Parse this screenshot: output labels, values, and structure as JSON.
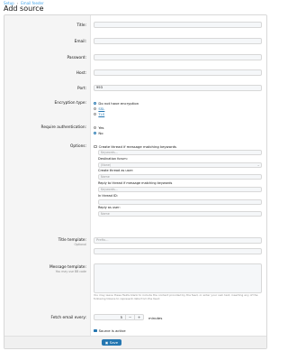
{
  "breadcrumb": {
    "item1": "Setup",
    "item2": "Email feeder"
  },
  "page_title": "Add source",
  "fields": {
    "title": {
      "label": "Title:",
      "value": ""
    },
    "email": {
      "label": "Email:",
      "value": ""
    },
    "password": {
      "label": "Password:",
      "value": ""
    },
    "host": {
      "label": "Host:",
      "value": ""
    },
    "port": {
      "label": "Port:",
      "value": "993"
    }
  },
  "encryption": {
    "label": "Encryption type:",
    "options": [
      "Do not have encryption",
      "SSL",
      "TLS"
    ],
    "selected": "Do not have encryption"
  },
  "auth": {
    "label": "Require authentication:",
    "options": [
      "Yes",
      "No"
    ],
    "selected": "No"
  },
  "options": {
    "label": "Options:",
    "checkbox_label": "Create thread if message matching keywords",
    "keywords_placeholder": "Keywords...",
    "destination_label": "Destination forum:",
    "destination_value": "(None)",
    "create_as_label": "Create thread as user:",
    "create_as_placeholder": "Name",
    "reply_label": "Reply to thread if message matching keywords",
    "reply_keywords_placeholder": "Keywords...",
    "thread_id_label": "In thread ID:",
    "reply_as_label": "Reply as user:",
    "reply_as_placeholder": "Name"
  },
  "title_template": {
    "label": "Title template:",
    "sublabel": "Optional",
    "placeholder": "Prefix..."
  },
  "message_template": {
    "label": "Message template:",
    "sublabel": "You may use BB code",
    "help": "You may leave these fields blank to include the content provided by the feed, or enter your own text, inserting any of the following tokens to represent data from the feed:"
  },
  "fetch": {
    "label": "Fetch email every:",
    "value": "5",
    "minus": "−",
    "plus": "+",
    "unit": "minutes"
  },
  "active": {
    "label": "Source is active"
  },
  "save": {
    "label": "Save"
  }
}
